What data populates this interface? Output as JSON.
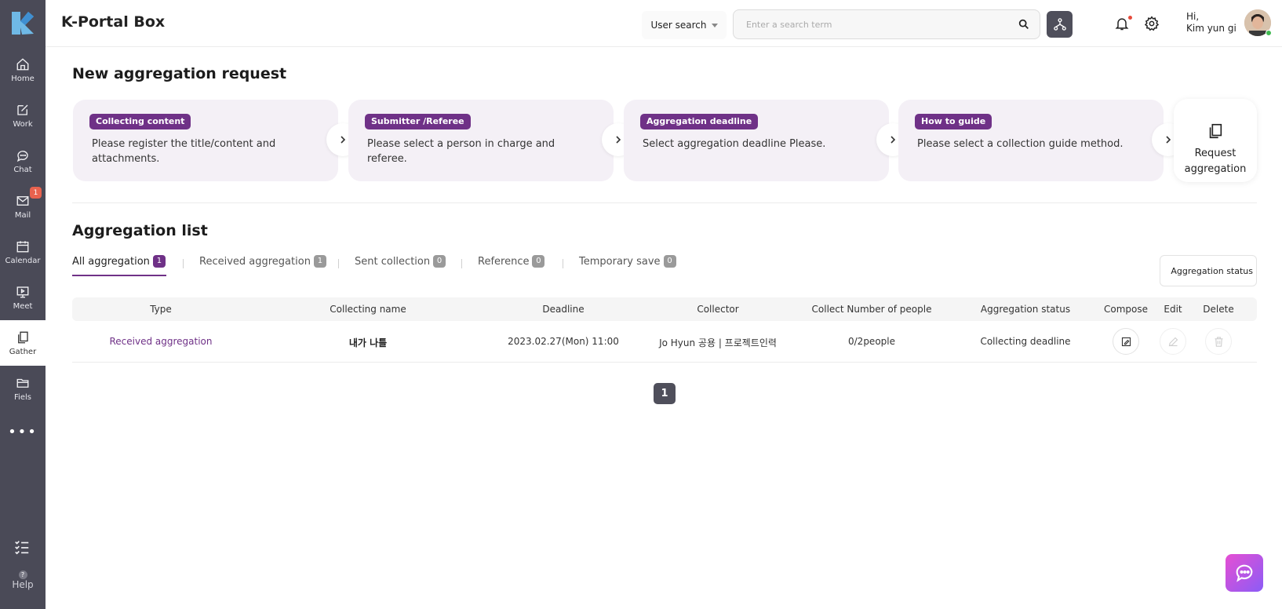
{
  "header": {
    "app_title": "K-Portal Box",
    "search_scope": "User search",
    "search_placeholder": "Enter a search term",
    "greeting_line1": "Hi,",
    "greeting_line2": "Kim yun gi"
  },
  "sidebar": {
    "items": [
      {
        "label": "Home"
      },
      {
        "label": "Work"
      },
      {
        "label": "Chat"
      },
      {
        "label": "Mail",
        "badge": "1"
      },
      {
        "label": "Calendar"
      },
      {
        "label": "Meet"
      },
      {
        "label": "Gather"
      },
      {
        "label": "Fiels"
      }
    ],
    "more": "•••",
    "help": "Help",
    "help_mark": "?"
  },
  "request_section": {
    "title": "New aggregation request",
    "steps": [
      {
        "tag": "Collecting content",
        "desc": "Please register the title/content and attachments."
      },
      {
        "tag": "Submitter /Referee",
        "desc": "Please select a person in charge and referee."
      },
      {
        "tag": "Aggregation deadline",
        "desc": "Select aggregation deadline Please."
      },
      {
        "tag": "How to guide",
        "desc": "Please select a collection guide method."
      }
    ],
    "request_button_line1": "Request",
    "request_button_line2": "aggregation"
  },
  "list_section": {
    "title": "Aggregation list",
    "tabs": [
      {
        "label": "All aggregation",
        "count": "1"
      },
      {
        "label": "Received aggregation",
        "count": "1"
      },
      {
        "label": "Sent collection",
        "count": "0"
      },
      {
        "label": "Reference",
        "count": "0"
      },
      {
        "label": "Temporary save",
        "count": "0"
      }
    ],
    "status_filter": "Aggregation status",
    "columns": [
      "Type",
      "Collecting name",
      "Deadline",
      "Collector",
      "Collect Number of people",
      "Aggregation status",
      "Compose",
      "Edit",
      "Delete"
    ],
    "rows": [
      {
        "type": "Received aggregation",
        "name": "내가 나틀",
        "deadline": "2023.02.27(Mon) 11:00",
        "collector": "Jo Hyun 공용 | 프로젝트인력",
        "people": "0/2people",
        "status": "Collecting deadline"
      }
    ],
    "page": "1"
  },
  "colors": {
    "sidebar_bg": "#4a4a57",
    "accent": "#6f3187",
    "card_bg": "#f4f0f6"
  }
}
